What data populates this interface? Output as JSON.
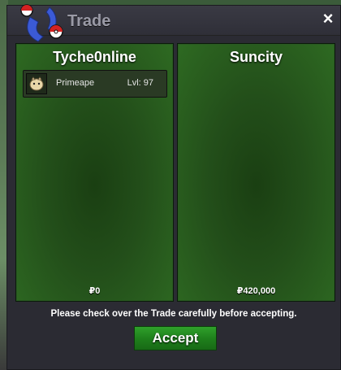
{
  "window": {
    "title": "Trade",
    "close_label": "×"
  },
  "left_panel": {
    "player_name": "Tyche0nline",
    "items": [
      {
        "name": "Primeape",
        "level": "Lvl: 97"
      }
    ],
    "money": "₽0"
  },
  "right_panel": {
    "player_name": "Suncity",
    "items": [],
    "money": "₽420,000"
  },
  "footer": {
    "notice": "Please check over the Trade carefully before accepting.",
    "accept_label": "Accept"
  },
  "colors": {
    "panel_green": "#2e6a22",
    "accept_green": "#1e7e1b",
    "window_bg": "#2b2b33"
  }
}
